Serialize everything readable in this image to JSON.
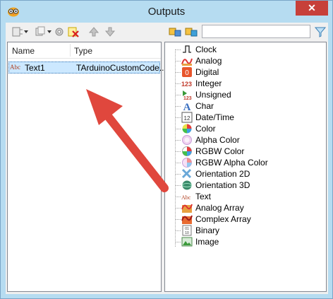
{
  "window": {
    "title": "Outputs",
    "close_glyph": "✕"
  },
  "toolbar": {
    "buttons": [
      "new-pin-icon",
      "add-pins-icon",
      "delete-icon",
      "move-up-icon",
      "move-down-icon",
      "expand-icon",
      "collapse-icon"
    ],
    "search": {
      "value": "",
      "placeholder": ""
    },
    "filter_icon": "funnel-icon"
  },
  "list": {
    "columns": [
      "Name",
      "Type"
    ],
    "rows": [
      {
        "icon": "text-icon",
        "icon_glyph": "Abc",
        "name": "Text1",
        "type": "TArduinoCustomCode..."
      }
    ]
  },
  "tree": {
    "items": [
      {
        "label": "Clock",
        "icon": "clock-icon"
      },
      {
        "label": "Analog",
        "icon": "analog-icon"
      },
      {
        "label": "Digital",
        "icon": "digital-icon"
      },
      {
        "label": "Integer",
        "icon": "integer-icon"
      },
      {
        "label": "Unsigned",
        "icon": "unsigned-icon"
      },
      {
        "label": "Char",
        "icon": "char-icon"
      },
      {
        "label": "Date/Time",
        "icon": "datetime-icon"
      },
      {
        "label": "Color",
        "icon": "color-icon"
      },
      {
        "label": "Alpha Color",
        "icon": "alpha-color-icon"
      },
      {
        "label": "RGBW Color",
        "icon": "rgbw-color-icon"
      },
      {
        "label": "RGBW Alpha Color",
        "icon": "rgbw-alpha-color-icon"
      },
      {
        "label": "Orientation 2D",
        "icon": "orientation-2d-icon"
      },
      {
        "label": "Orientation 3D",
        "icon": "orientation-3d-icon"
      },
      {
        "label": "Text",
        "icon": "text-icon"
      },
      {
        "label": "Analog Array",
        "icon": "analog-array-icon"
      },
      {
        "label": "Complex Array",
        "icon": "complex-array-icon"
      },
      {
        "label": "Binary",
        "icon": "binary-icon"
      },
      {
        "label": "Image",
        "icon": "image-icon"
      }
    ]
  },
  "colors": {
    "title_bar": "#b6dcf1",
    "close": "#c7403a",
    "selection": "#cce8ff",
    "arrow": "#e0473d"
  }
}
